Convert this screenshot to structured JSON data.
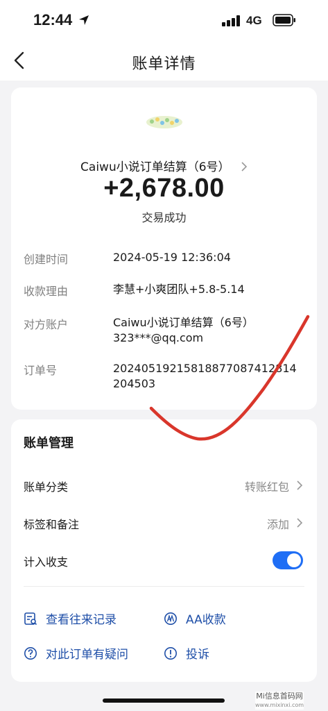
{
  "status_bar": {
    "time": "12:44",
    "network": "4G"
  },
  "nav": {
    "title": "账单详情"
  },
  "transaction": {
    "merchant": "Caiwu小说订单结算（6号）",
    "amount": "+2,678.00",
    "status": "交易成功",
    "details": [
      {
        "label": "创建时间",
        "value": "2024-05-19 12:36:04"
      },
      {
        "label": "收款理由",
        "value": "李慧+小爽团队+5.8-5.14"
      },
      {
        "label": "对方账户",
        "value": "Caiwu小说订单结算（6号）",
        "value2": "323***@qq.com"
      },
      {
        "label": "订单号",
        "value": "20240519215818877087412814",
        "value2": "204503"
      }
    ]
  },
  "manage": {
    "title": "账单管理",
    "category_label": "账单分类",
    "category_value": "转账红包",
    "tags_label": "标签和备注",
    "tags_value": "添加",
    "include_label": "计入收支",
    "include_enabled": true
  },
  "actions": {
    "records": "查看往来记录",
    "aa": "AA收款",
    "question": "对此订单有疑问",
    "complaint": "投诉"
  },
  "watermark": {
    "line1": "Mi信息首码网",
    "line2": "www.mixinxi.com"
  },
  "colors": {
    "accent": "#1f6ef5",
    "link": "#1f4fa8",
    "mark": "#d9362b",
    "background": "#f3f3f5"
  }
}
